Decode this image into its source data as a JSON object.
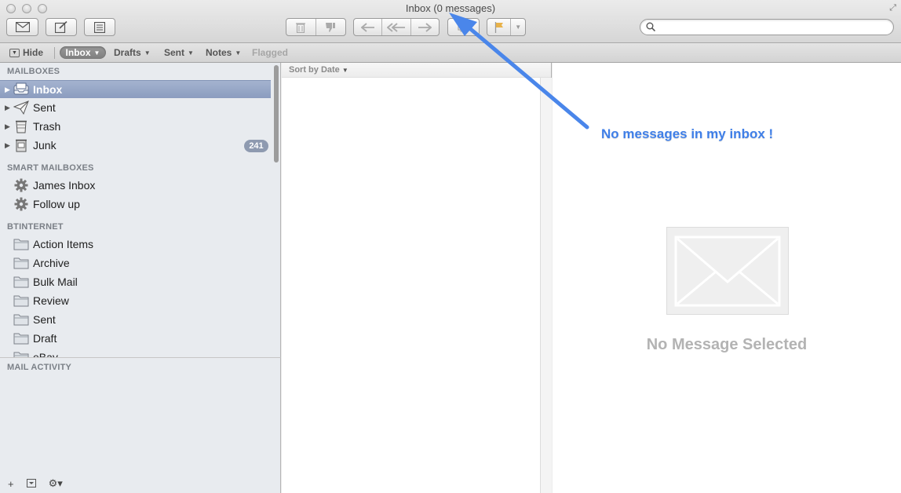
{
  "window": {
    "title": "Inbox (0 messages)"
  },
  "toolbar": {
    "buttons": [
      {
        "name": "get-mail",
        "icon": "envelope-icon"
      },
      {
        "name": "compose",
        "icon": "compose-icon"
      },
      {
        "name": "note",
        "icon": "note-icon"
      },
      {
        "name": "delete",
        "icon": "trash-icon"
      },
      {
        "name": "junk",
        "icon": "thumbs-down-icon"
      },
      {
        "name": "reply",
        "icon": "reply-icon"
      },
      {
        "name": "reply-all",
        "icon": "reply-all-icon"
      },
      {
        "name": "forward",
        "icon": "forward-icon"
      },
      {
        "name": "flag",
        "icon": "flag-icon"
      }
    ],
    "search_placeholder": ""
  },
  "favorites": {
    "hide_label": "Hide",
    "items": [
      {
        "label": "Inbox",
        "active": true
      },
      {
        "label": "Drafts"
      },
      {
        "label": "Sent"
      },
      {
        "label": "Notes"
      },
      {
        "label": "Flagged",
        "disabled": true
      }
    ]
  },
  "sidebar": {
    "mailboxes_heading": "MAILBOXES",
    "mailboxes": [
      {
        "label": "Inbox",
        "icon": "inbox-tray-icon",
        "selected": true
      },
      {
        "label": "Sent",
        "icon": "paper-plane-icon"
      },
      {
        "label": "Trash",
        "icon": "trash-can-icon"
      },
      {
        "label": "Junk",
        "icon": "junk-bin-icon",
        "badge": "241"
      }
    ],
    "smart_heading": "SMART MAILBOXES",
    "smart": [
      {
        "label": "James Inbox",
        "icon": "gear-icon"
      },
      {
        "label": "Follow up",
        "icon": "gear-icon"
      }
    ],
    "account_heading": "BTINTERNET",
    "folders": [
      {
        "label": "Action Items",
        "icon": "folder-icon"
      },
      {
        "label": "Archive",
        "icon": "folder-icon"
      },
      {
        "label": "Bulk Mail",
        "icon": "folder-icon"
      },
      {
        "label": "Review",
        "icon": "folder-icon"
      },
      {
        "label": "Sent",
        "icon": "folder-icon"
      },
      {
        "label": "Draft",
        "icon": "folder-icon"
      },
      {
        "label": "eBay",
        "icon": "folder-icon"
      }
    ],
    "activity_heading": "MAIL ACTIVITY"
  },
  "message_list": {
    "sort_label": "Sort by Date"
  },
  "preview": {
    "empty_text": "No Message Selected"
  },
  "annotation": {
    "text": "No messages in my inbox !",
    "color": "#3f7fe8"
  },
  "colors": {
    "selection": "#8b9cbf",
    "badge": "#8e9ab0"
  }
}
